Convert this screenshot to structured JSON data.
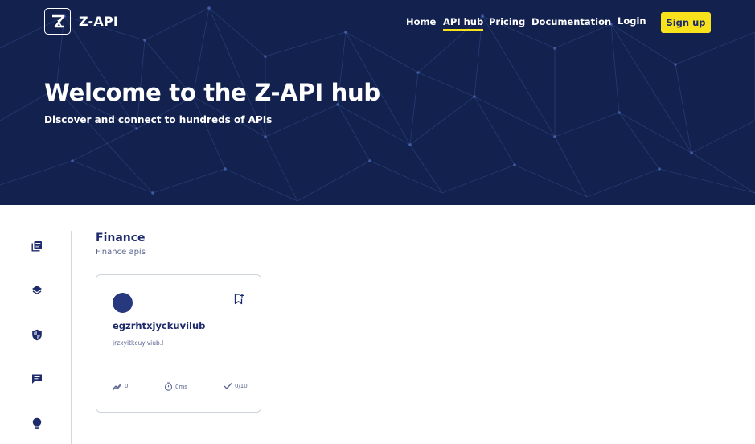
{
  "brand": {
    "name": "Z-API",
    "logo_icon": "z-api-logo-icon"
  },
  "nav": {
    "items": [
      {
        "label": "Home",
        "active": false
      },
      {
        "label": "API hub",
        "active": true
      },
      {
        "label": "Pricing",
        "active": false
      },
      {
        "label": "Documentation",
        "active": false
      },
      {
        "label": "Login",
        "active": false
      }
    ],
    "signup_label": "Sign up"
  },
  "hero": {
    "title": "Welcome to the Z-API hub",
    "subtitle": "Discover and connect to hundreds of APIs"
  },
  "sidebar": {
    "icons": [
      "library-books-icon",
      "layers-icon",
      "shield-icon",
      "chat-icon",
      "lightbulb-icon"
    ]
  },
  "section": {
    "title": "Finance",
    "subtitle": "Finance apis"
  },
  "cards": [
    {
      "title": "egzrhtxjyckuvilub",
      "description": "jrzxyitkcuylviub.l",
      "stats": {
        "popularity": "0",
        "latency": "0ms",
        "success": "0/10"
      }
    }
  ],
  "colors": {
    "hero_bg": "#13214f",
    "accent": "#f7e21c",
    "primary_text": "#1d2a6b",
    "avatar": "#27387e"
  }
}
